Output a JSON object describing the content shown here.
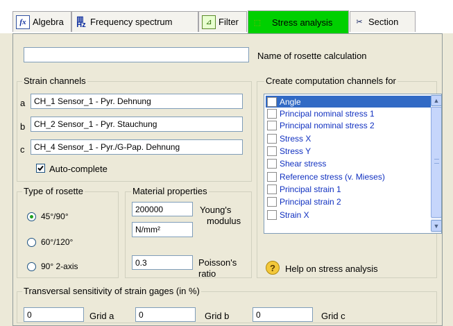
{
  "tabs": [
    {
      "label": "Algebra",
      "icon": "algebra-icon"
    },
    {
      "label": "Frequency spectrum",
      "icon": "frequency-spectrum-icon"
    },
    {
      "label": "Filter",
      "icon": "filter-icon"
    },
    {
      "label": "Stress analysis",
      "icon": "stress-analysis-icon",
      "active": true
    },
    {
      "label": "Section",
      "icon": "section-icon"
    }
  ],
  "rosette_name": {
    "value": "",
    "label": "Name of rosette calculation"
  },
  "strain_channels": {
    "title": "Strain channels",
    "channels": [
      {
        "letter": "a",
        "value": "CH_1 Sensor_1 - Pyr. Dehnung"
      },
      {
        "letter": "b",
        "value": "CH_2 Sensor_1 - Pyr. Stauchung"
      },
      {
        "letter": "c",
        "value": "CH_4 Sensor_1 - Pyr./G-Pap. Dehnung"
      }
    ],
    "auto_complete": {
      "label": "Auto-complete",
      "checked": true
    }
  },
  "rosette_type": {
    "title": "Type of rosette",
    "options": [
      "45°/90°",
      "60°/120°",
      "90° 2-axis"
    ],
    "selected": "45°/90°"
  },
  "material": {
    "title": "Material properties",
    "youngs_value": "200000",
    "youngs_label_1": "Young's",
    "youngs_label_2": "modulus",
    "unit": "N/mm²",
    "poisson_value": "0.3",
    "poisson_label_1": "Poisson's",
    "poisson_label_2": "ratio"
  },
  "computation": {
    "title": "Create computation channels for",
    "items": [
      "Angle",
      "Principal nominal stress 1",
      "Principal nominal stress 2",
      "Stress X",
      "Stress Y",
      "Shear stress",
      "Reference stress (v. Mieses)",
      "Principal strain 1",
      "Principal strain 2",
      "Strain X"
    ],
    "selected": "Angle",
    "help": "Help on stress analysis"
  },
  "transversal": {
    "title": "Transversal sensitivity of strain gages (in %)",
    "grids": [
      {
        "label": "Grid a",
        "value": "0"
      },
      {
        "label": "Grid b",
        "value": "0"
      },
      {
        "label": "Grid c",
        "value": "0"
      }
    ]
  },
  "colors": {
    "active_tab": "#00d000",
    "selection": "#316ac5",
    "list_text": "#1030c0"
  }
}
